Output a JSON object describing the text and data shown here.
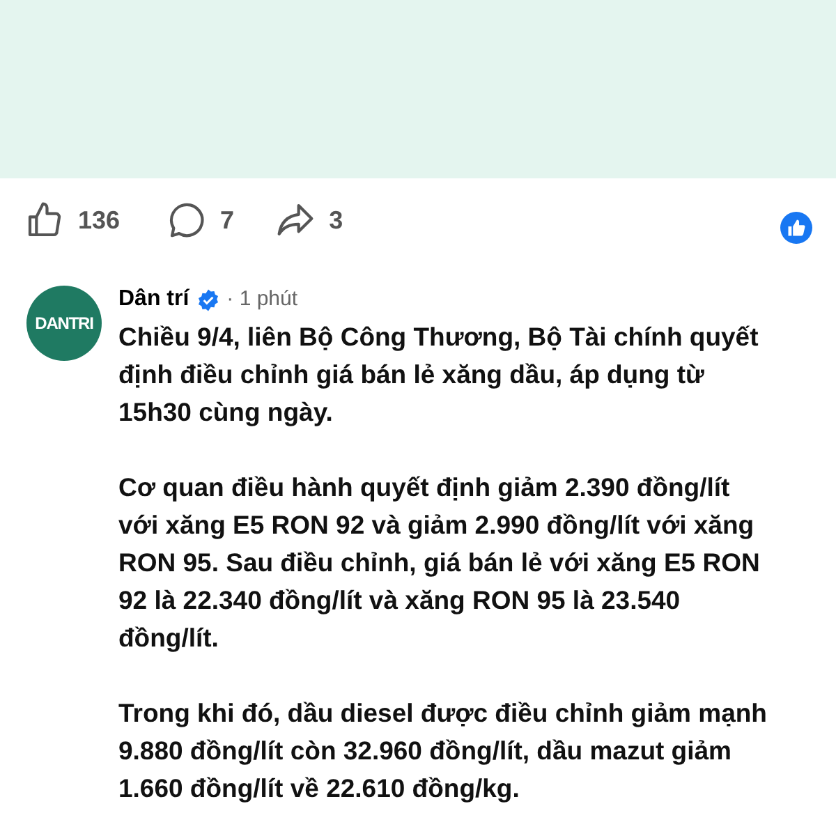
{
  "reactions": {
    "likes": "136",
    "comments": "7",
    "shares": "3"
  },
  "post": {
    "logo_text": "DANTRI",
    "author": "Dân trí",
    "verified": true,
    "time": "· 1 phút",
    "paragraphs": [
      "Chiều 9/4, liên Bộ Công Thương, Bộ Tài chính quyết định điều chỉnh giá bán lẻ xăng dầu, áp dụng từ 15h30 cùng ngày.",
      "Cơ quan điều hành quyết định giảm 2.390 đồng/lít với xăng E5 RON 92 và giảm 2.990 đồng/lít với xăng RON 95. Sau điều chỉnh, giá bán lẻ với xăng E5 RON 92 là 22.340 đồng/lít và xăng RON 95 là 23.540 đồng/lít.",
      "Trong khi đó, dầu diesel được điều chỉnh giảm mạnh 9.880 đồng/lít còn 32.960 đồng/lít, dầu mazut giảm 1.660 đồng/lít về 22.610 đồng/kg."
    ]
  }
}
